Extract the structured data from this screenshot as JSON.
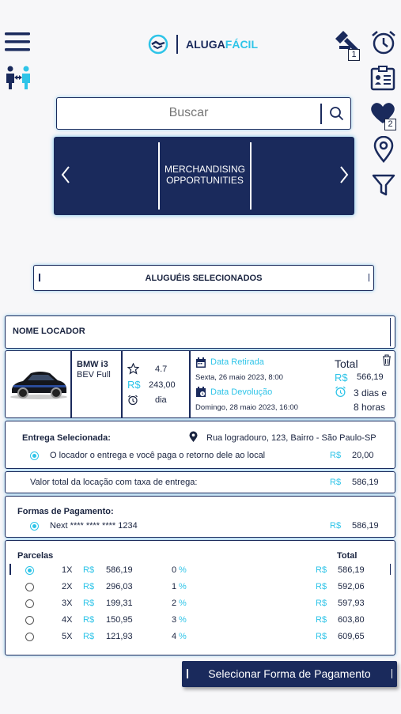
{
  "brand": {
    "prefix": "ALUGA",
    "suffix": "FÁCIL"
  },
  "header": {
    "gavel_badge": "1",
    "favorites_badge": "2"
  },
  "search": {
    "placeholder": "Buscar"
  },
  "banner": {
    "text": "MERCHANDISING OPPORTUNITIES"
  },
  "selected_rentals": {
    "title": "ALUGUÉIS SELECIONADOS"
  },
  "owner": {
    "label": "NOME LOCADOR"
  },
  "car": {
    "model": "BMW i3",
    "version": "BEV Full",
    "rating": "4.7",
    "currency": "R$",
    "daily_price": "243,00",
    "daily_unit": "dia",
    "pickup_label": "Data Retirada",
    "pickup_date": "Sexta, 26 maio 2023, 8:00",
    "return_label": "Data Devolução",
    "return_date": "Domingo, 28 maio 2023, 16:00",
    "total_label": "Total",
    "total_value": "566,19",
    "duration_days": "3 dias e",
    "duration_hours": "8 horas"
  },
  "delivery": {
    "label": "Entrega Selecionada:",
    "address": "Rua logradouro, 123, Bairro - São Paulo-SP",
    "option_text": "O locador o entrega e você paga o retorno dele ao local",
    "currency": "R$",
    "price": "20,00"
  },
  "total_delivery": {
    "label": "Valor total da locação com taxa de entrega:",
    "currency": "R$",
    "value": "586,19"
  },
  "payment": {
    "label": "Formas de Pagamento:",
    "card": "Next **** **** **** 1234",
    "currency": "R$",
    "value": "586,19"
  },
  "installments": {
    "label": "Parcelas",
    "total_label": "Total",
    "rows": [
      {
        "n": "1X",
        "cur": "R$",
        "value": "586,19",
        "rate": "0",
        "pct": "%",
        "total": "586,19",
        "selected": true
      },
      {
        "n": "2X",
        "cur": "R$",
        "value": "296,03",
        "rate": "1",
        "pct": "%",
        "total": "592,06",
        "selected": false
      },
      {
        "n": "3X",
        "cur": "R$",
        "value": "199,31",
        "rate": "2",
        "pct": "%",
        "total": "597,93",
        "selected": false
      },
      {
        "n": "4X",
        "cur": "R$",
        "value": "150,95",
        "rate": "3",
        "pct": "%",
        "total": "603,80",
        "selected": false
      },
      {
        "n": "5X",
        "cur": "R$",
        "value": "121,93",
        "rate": "4",
        "pct": "%",
        "total": "609,65",
        "selected": false
      }
    ]
  },
  "cta": {
    "label": "Selecionar Forma de Pagamento"
  },
  "colors": {
    "navy": "#1a2a5c",
    "cyan": "#2ec4e8",
    "background": "#f7f7f9"
  },
  "icons": [
    "menu-icon",
    "people-exchange-icon",
    "handshake-logo-icon",
    "gavel-icon",
    "alarm-clock-icon",
    "id-card-icon",
    "heart-icon",
    "location-pin-icon",
    "filter-icon",
    "search-icon",
    "chevron-left-icon",
    "chevron-right-icon",
    "trash-icon",
    "star-icon",
    "calendar-icon"
  ]
}
